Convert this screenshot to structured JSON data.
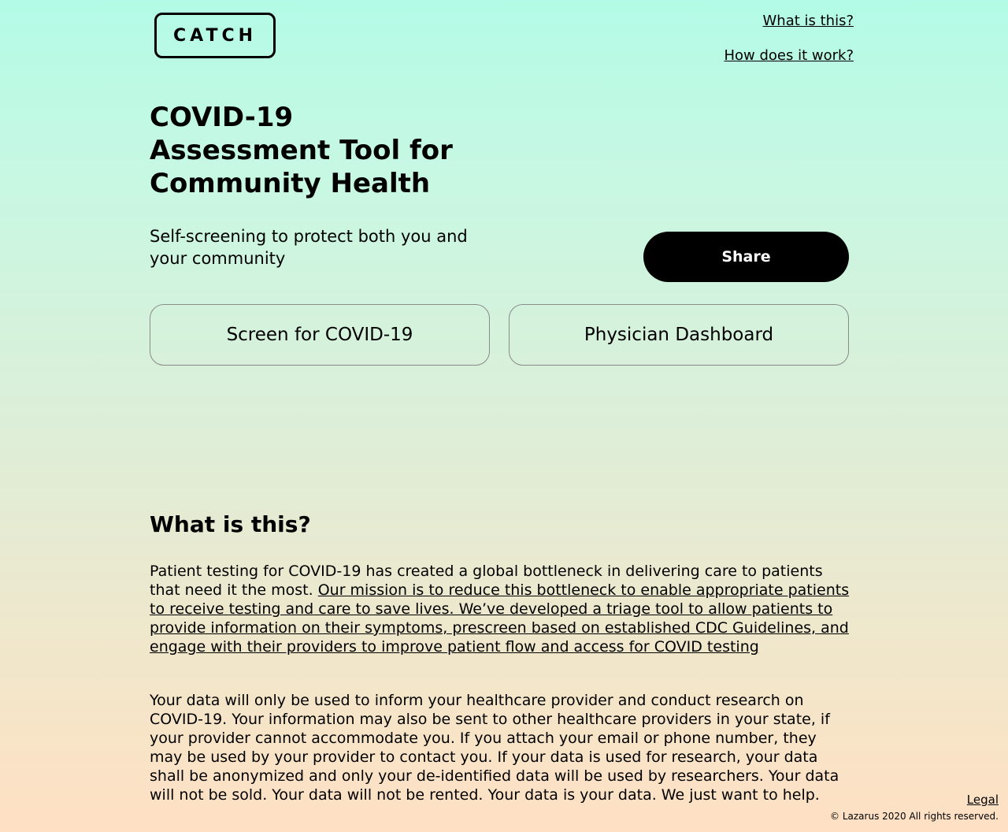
{
  "header": {
    "logo_text": "CATCH",
    "nav": [
      {
        "label": "What is this?"
      },
      {
        "label": "How does it work?"
      }
    ]
  },
  "hero": {
    "title": "COVID-19 Assessment Tool for Community Health",
    "subtitle": "Self-screening to protect both you and your community",
    "share_label": "Share"
  },
  "actions": {
    "screen_label": "Screen for COVID-19",
    "physician_label": "Physician Dashboard"
  },
  "about": {
    "title": "What is this?",
    "para1_plain": "Patient testing for COVID-19 has created a global bottleneck in delivering care to patients that need it the most. ",
    "para1_link": "Our mission is to reduce this bottleneck to enable appropriate patients to receive testing and care to save lives. We’ve developed a triage tool to allow patients to provide information on their symptoms, prescreen based on established CDC Guidelines, and engage with their providers to improve patient flow and access for COVID testing",
    "para2": "Your data will only be used to inform your healthcare provider and conduct research on COVID-19. Your information may also be sent to other healthcare providers in your state, if your provider cannot accommodate you. If you attach your email or phone number, they may be used by your provider to contact you. If your data is used for research, your data shall be anonymized and only your de-identified data will be used by researchers. Your data will not be sold. Your data will not be rented. Your data is your data. We just want to help."
  },
  "footer": {
    "legal_label": "Legal",
    "copyright": "© Lazarus 2020 All rights reserved."
  },
  "colors": {
    "gradient_top": "#b3fbe6",
    "gradient_bottom": "#ffe0c4",
    "primary": "#000000"
  }
}
